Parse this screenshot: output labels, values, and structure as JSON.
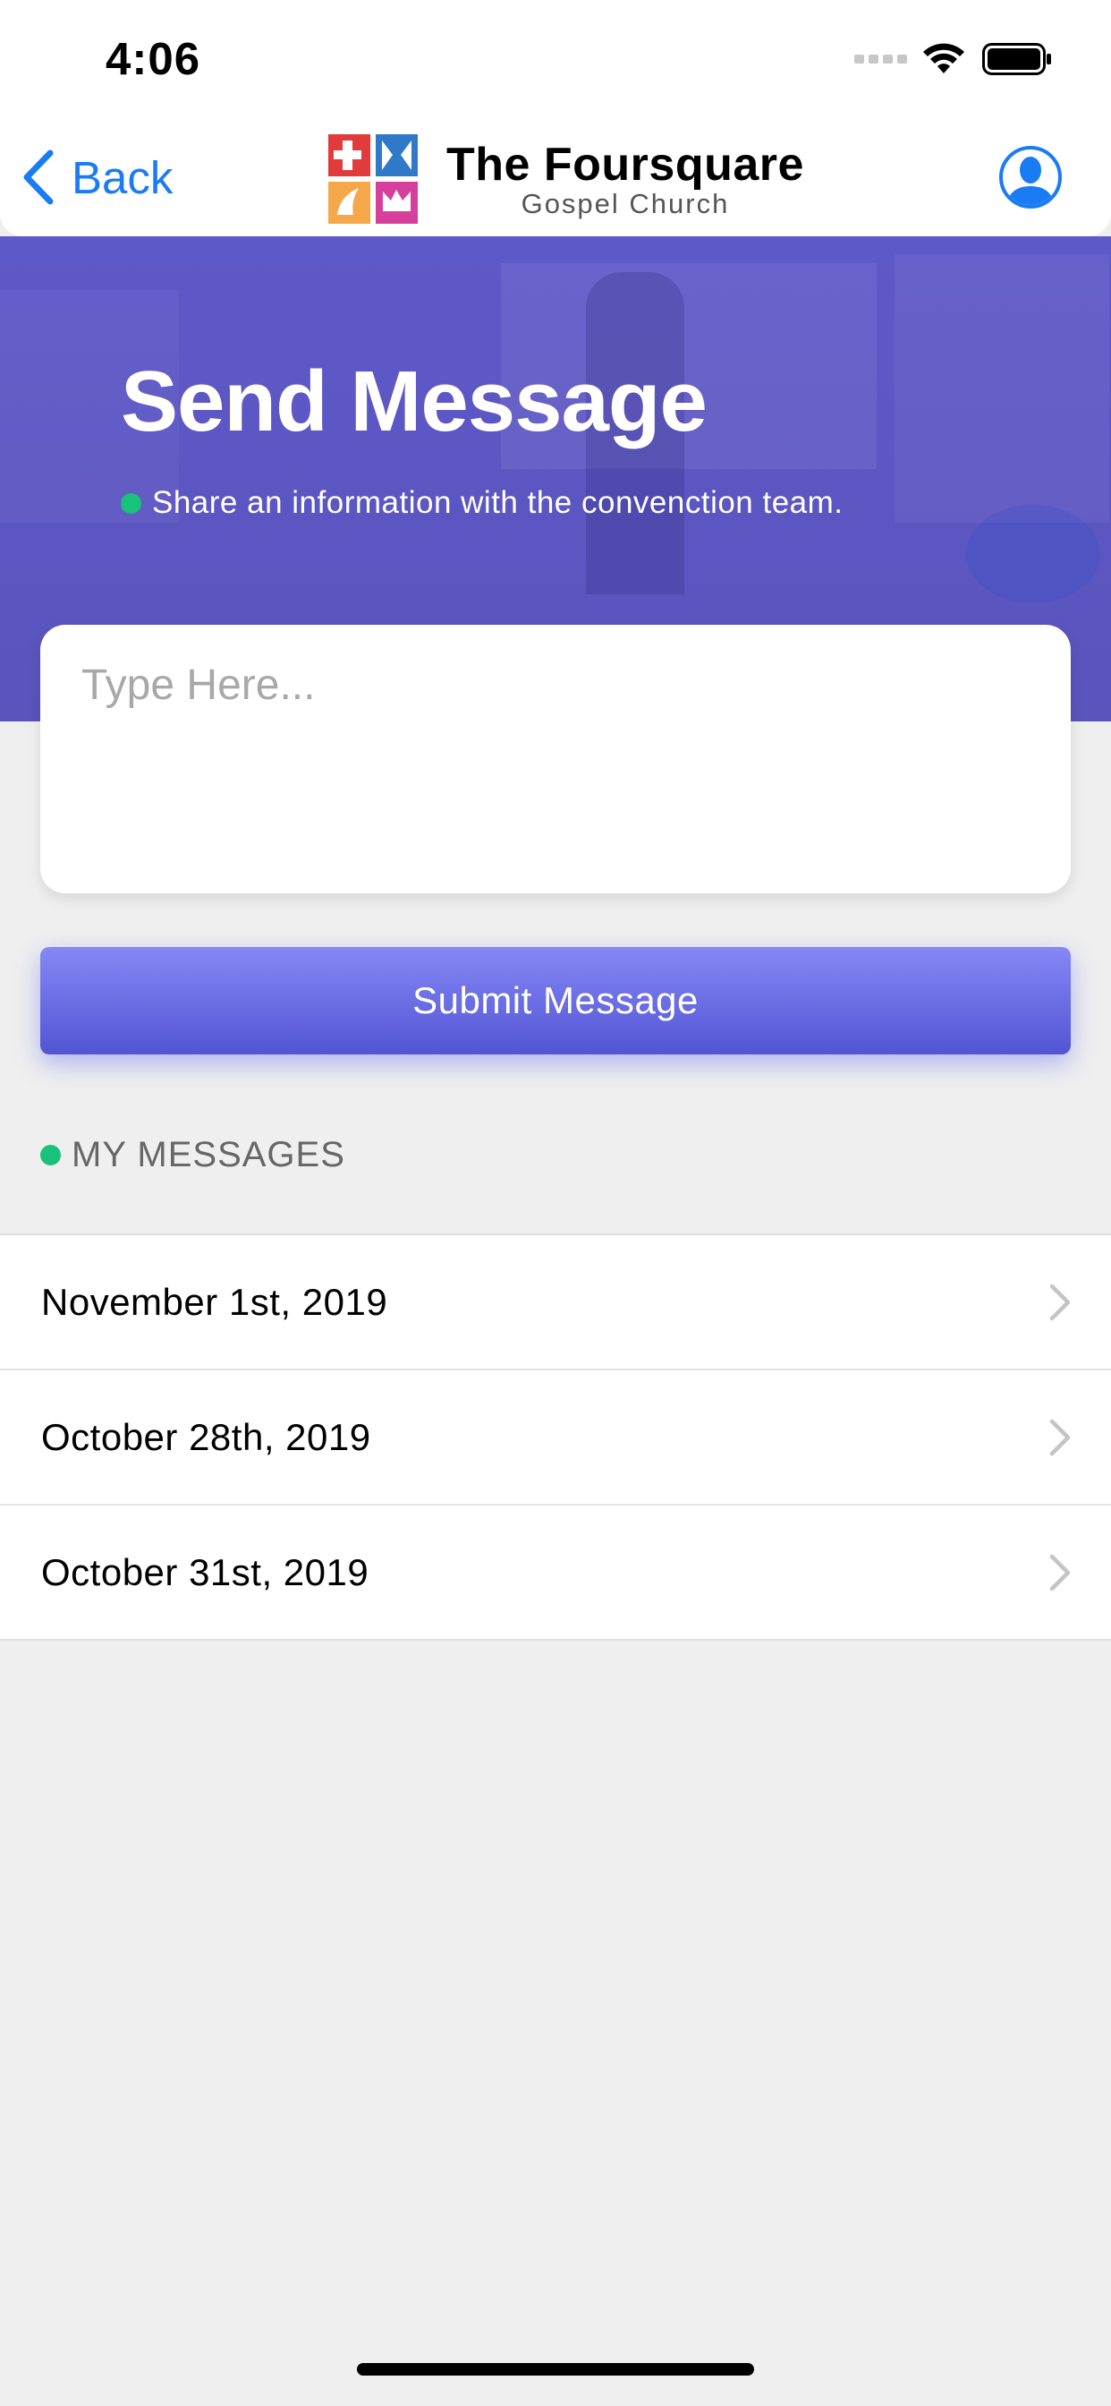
{
  "status_bar": {
    "time": "4:06"
  },
  "nav": {
    "back_label": "Back",
    "brand_title": "The Foursquare",
    "brand_subtitle": "Gospel Church"
  },
  "hero": {
    "title": "Send Message",
    "subtitle": "Share an information with the convenction team."
  },
  "compose": {
    "placeholder": "Type Here...",
    "submit_label": "Submit Message"
  },
  "messages": {
    "header": "MY MESSAGES",
    "items": [
      {
        "label": "November 1st, 2019"
      },
      {
        "label": "October 28th, 2019"
      },
      {
        "label": "October 31st, 2019"
      }
    ]
  },
  "colors": {
    "accent_blue": "#1a7cf5",
    "hero_purple": "#5e59c8",
    "button_top": "#8588f5",
    "button_bottom": "#5255d3",
    "status_green": "#19c27a",
    "background": "#efefef"
  },
  "icons": {
    "back": "chevron-left-icon",
    "profile": "user-profile-icon",
    "row_disclosure": "chevron-right-icon",
    "status": [
      "cellular-signal-icon",
      "wifi-icon",
      "battery-icon"
    ]
  }
}
